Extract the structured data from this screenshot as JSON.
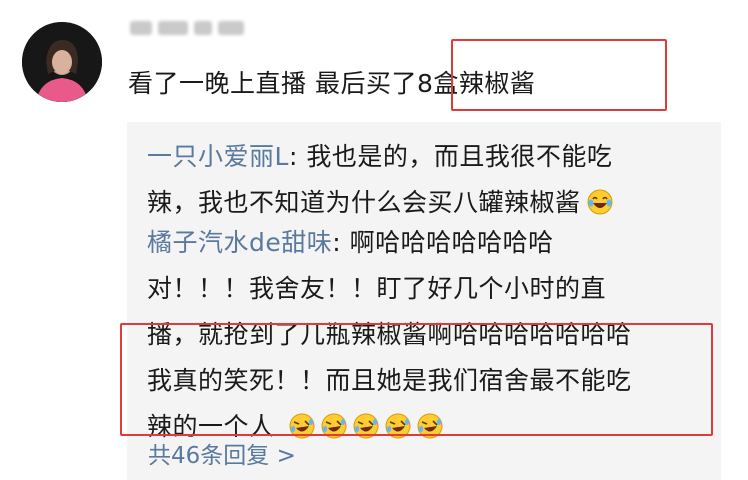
{
  "post": {
    "text": "看了一晚上直播 最后买了8盒辣椒酱"
  },
  "replies": [
    {
      "author": "一只小爱丽L",
      "lines": [
        "我也是的，而且我很不能吃",
        "辣，我也不知道为什么会买八罐辣椒酱"
      ],
      "emoji_count": 1,
      "emoji_name": "laughing-tears-emoji"
    },
    {
      "author": "橘子汽水de甜味",
      "lines": [
        "啊哈哈哈哈哈哈哈",
        "对！！！我舍友！！盯了好几个小时的直",
        "播，就抢到了几瓶辣椒酱啊哈哈哈哈哈哈哈",
        "我真的笑死！！而且她是我们宿舍最不能吃",
        "辣的一个人"
      ],
      "emoji_count": 5,
      "emoji_name": "rolling-laughing-emoji"
    }
  ],
  "more_replies": "共46条回复 >",
  "colors": {
    "author": "#59799e",
    "highlight": "#e03a3a",
    "panel": "#f4f4f4"
  }
}
